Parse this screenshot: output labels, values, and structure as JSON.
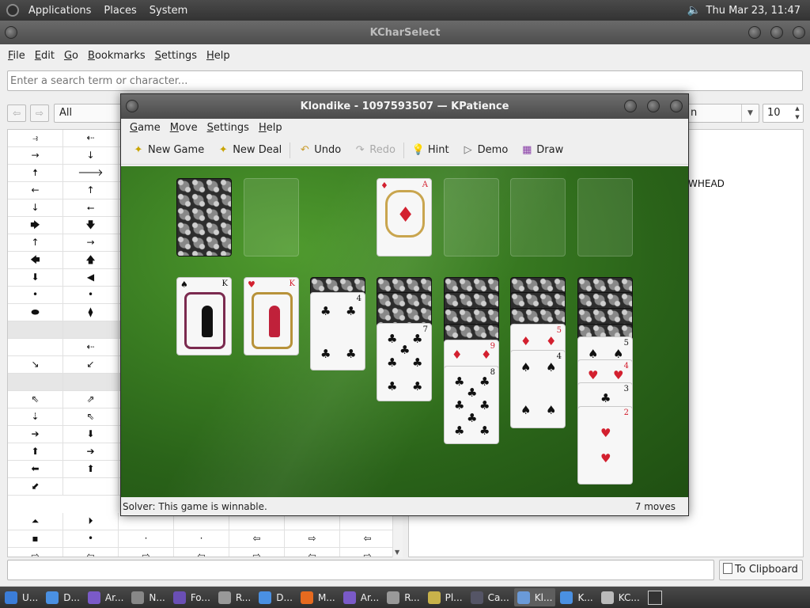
{
  "top_panel": {
    "menus": [
      "Applications",
      "Places",
      "System"
    ],
    "clock": "Thu Mar 23, 11:47"
  },
  "kcharselect": {
    "title": "KCharSelect",
    "menu": [
      "File",
      "Edit",
      "Go",
      "Bookmarks",
      "Settings",
      "Help"
    ],
    "search_placeholder": "Enter a search term or character...",
    "category": "All",
    "font_visible": "n",
    "font_size": "10",
    "detail_fragment": "WHEAD",
    "clipboard_button": "To Clipboard",
    "grid_rows": [
      [
        "⥽",
        "⇠"
      ],
      [
        "→",
        "↓"
      ],
      [
        "🠅",
        "🡒"
      ],
      [
        "←",
        "↑"
      ],
      [
        "↓",
        "⭠"
      ],
      [
        "🡆",
        "🡇"
      ],
      [
        "↑",
        "→"
      ],
      [
        "🡄",
        "🡅"
      ],
      [
        "⬇",
        "◀"
      ],
      [
        "•",
        "•"
      ],
      [
        "⬬",
        "⧫"
      ],
      [
        "",
        ""
      ],
      [
        "",
        "⇠"
      ],
      [
        "↘",
        "↙"
      ],
      [
        "",
        ""
      ],
      [
        "⇖",
        "⇗"
      ],
      [
        "⇣",
        "⇖"
      ],
      [
        "➔",
        "⬇"
      ],
      [
        "⬆",
        "➔"
      ],
      [
        "⬅",
        "⬆"
      ],
      [
        "⬋",
        ""
      ]
    ],
    "grid_bottom_rows": [
      [
        "⏶",
        "⏵",
        "",
        "",
        "",
        "",
        ""
      ],
      [
        "▪",
        "•",
        "·",
        "·",
        "⇦",
        "⇨",
        "⇦"
      ],
      [
        "⇨",
        "⇦",
        "⇨",
        "⇦",
        "⇨",
        "⇦",
        "⇨"
      ]
    ]
  },
  "kpatience": {
    "title": "Klondike - 1097593507 — KPatience",
    "menu": [
      "Game",
      "Move",
      "Settings",
      "Help"
    ],
    "toolbar": {
      "new_game": "New Game",
      "new_deal": "New Deal",
      "undo": "Undo",
      "redo": "Redo",
      "hint": "Hint",
      "demo": "Demo",
      "draw": "Draw"
    },
    "status_left": "Solver: This game is winnable.",
    "status_right": "7 moves",
    "foundations": {
      "f1": {
        "rank": "A",
        "suit": "♦"
      }
    },
    "tableau": {
      "col1": {
        "rank": "K",
        "suit": "♠"
      },
      "col2": {
        "rank": "K",
        "suit": "♥"
      },
      "col3": {
        "rank": "4",
        "suit": "♣"
      },
      "col4": {
        "rank": "7",
        "suit": "♣"
      },
      "col5": [
        {
          "rank": "9",
          "suit": "♦"
        },
        {
          "rank": "8",
          "suit": "♣"
        }
      ],
      "col6": [
        {
          "rank": "5",
          "suit": "♦"
        },
        {
          "rank": "4",
          "suit": "♠"
        }
      ],
      "col7": [
        {
          "rank": "5",
          "suit": "♠"
        },
        {
          "rank": "4",
          "suit": "♥"
        },
        {
          "rank": "3",
          "suit": "♣"
        },
        {
          "rank": "2",
          "suit": "♥"
        }
      ]
    }
  },
  "taskbar": {
    "items": [
      "U...",
      "D...",
      "Ar...",
      "N...",
      "Fo...",
      "R...",
      "D...",
      "M...",
      "Ar...",
      "R...",
      "Pl...",
      "Ca...",
      "Kl...",
      "K...",
      "KC..."
    ]
  }
}
